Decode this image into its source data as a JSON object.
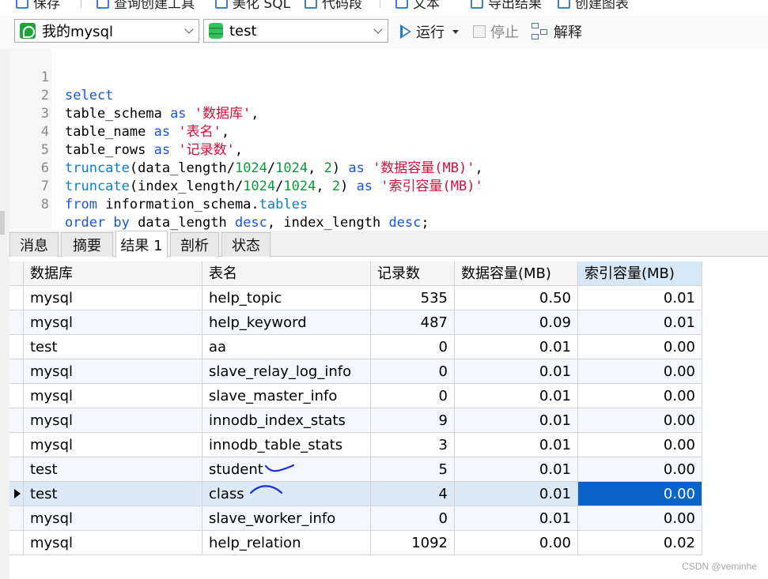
{
  "toolbar_top": {
    "items": [
      {
        "label": "保存"
      },
      {
        "label": "查询创建工具"
      },
      {
        "label": "美化 SQL"
      },
      {
        "label": "代码段"
      },
      {
        "label": "文本"
      },
      {
        "label": "导出结果"
      },
      {
        "label": "创建图表"
      }
    ]
  },
  "toolbar": {
    "connection": "我的mysql",
    "database": "test",
    "run_label": "运行",
    "stop_label": "停止",
    "explain_label": "解释"
  },
  "editor": {
    "line_numbers": [
      "1",
      "2",
      "3",
      "4",
      "5",
      "6",
      "7",
      "8"
    ]
  },
  "result_tabs": [
    "消息",
    "摘要",
    "结果 1",
    "剖析",
    "状态"
  ],
  "result_tabs_active": "结果 1",
  "table": {
    "columns": [
      "数据库",
      "表名",
      "记录数",
      "数据容量(MB)",
      "索引容量(MB)"
    ],
    "rows": [
      [
        "mysql",
        "help_topic",
        "535",
        "0.50",
        "0.01"
      ],
      [
        "mysql",
        "help_keyword",
        "487",
        "0.09",
        "0.01"
      ],
      [
        "test",
        "aa",
        "0",
        "0.01",
        "0.00"
      ],
      [
        "mysql",
        "slave_relay_log_info",
        "0",
        "0.01",
        "0.00"
      ],
      [
        "mysql",
        "slave_master_info",
        "0",
        "0.01",
        "0.00"
      ],
      [
        "mysql",
        "innodb_index_stats",
        "9",
        "0.01",
        "0.00"
      ],
      [
        "mysql",
        "innodb_table_stats",
        "3",
        "0.01",
        "0.00"
      ],
      [
        "test",
        "student",
        "5",
        "0.01",
        "0.00"
      ],
      [
        "test",
        "class",
        "4",
        "0.01",
        "0.00"
      ],
      [
        "mysql",
        "slave_worker_info",
        "0",
        "0.01",
        "0.00"
      ],
      [
        "mysql",
        "help_relation",
        "1092",
        "0.00",
        "0.02"
      ]
    ],
    "current_row": 8
  },
  "watermark": "CSDN @veminhe",
  "colors": {
    "keyword": "#1a56db",
    "function": "#0b7fbf",
    "string": "#d0103a",
    "number": "#0a9a3a",
    "selection": "#0a64c8",
    "scribble": "#1c2fd6"
  }
}
